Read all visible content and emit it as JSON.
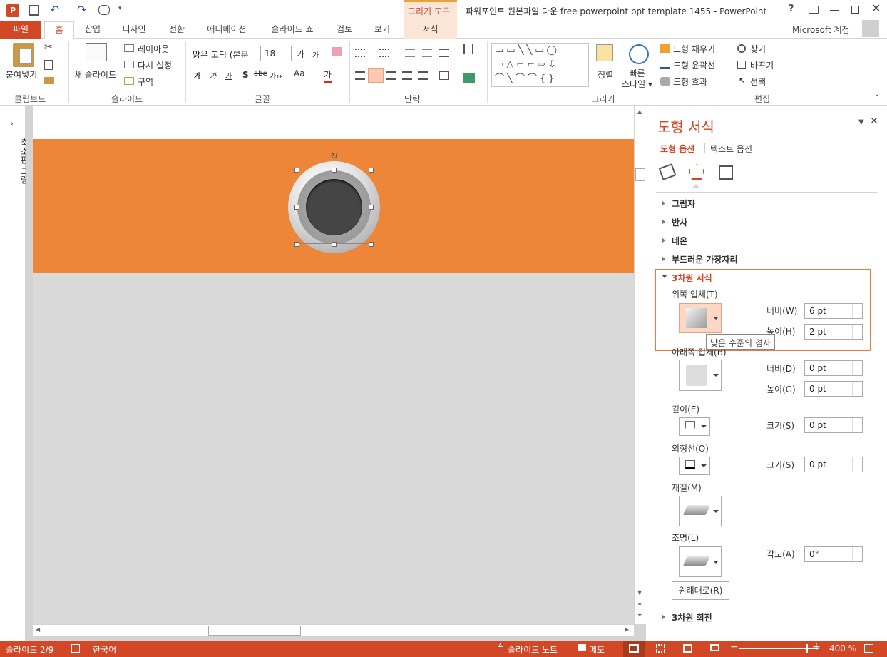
{
  "window": {
    "title": "파워포인트 원본파일 다운 free powerpoint ppt template 1455 - PowerPoint",
    "help": "?",
    "account": "Microsoft 계정"
  },
  "context_tab": {
    "group": "그리기 도구",
    "tab": "서식"
  },
  "tabs": [
    "파일",
    "홈",
    "삽입",
    "디자인",
    "전환",
    "애니메이션",
    "슬라이드 쇼",
    "검토",
    "보기"
  ],
  "ribbon": {
    "clipboard": {
      "paste": "붙여넣기",
      "label": "클립보드"
    },
    "slides": {
      "new_slide": "새 슬라이드",
      "layout": "레이아웃",
      "reset": "다시 설정",
      "section": "구역",
      "label": "슬라이드"
    },
    "font": {
      "name": "맑은 고딕 (본문",
      "size": "18",
      "label": "글꼴"
    },
    "paragraph": {
      "label": "단락"
    },
    "drawing": {
      "arrange": "정렬",
      "quick_styles": "빠른\n스타일",
      "fill": "도형 채우기",
      "outline": "도형 윤곽선",
      "effects": "도형 효과",
      "label": "그리기"
    },
    "editing": {
      "find": "찾기",
      "replace": "바꾸기",
      "select": "선택",
      "label": "편집"
    }
  },
  "left_strip": {
    "label": "축소판 그림"
  },
  "pane": {
    "title": "도형 서식",
    "tab_shape": "도형 옵션",
    "tab_text": "텍스트 옵션",
    "sections": {
      "shadow": "그림자",
      "reflection": "반사",
      "glow": "네온",
      "soft_edges": "부드러운 가장자리",
      "format3d": "3차원 서식",
      "rotation3d": "3차원 회전"
    },
    "top_bevel": {
      "label": "위쪽 입체(T)",
      "width_label": "너비(W)",
      "width": "6 pt",
      "height_label": "높이(H)",
      "height": "2 pt",
      "tooltip": "낮은 수준의 경사"
    },
    "bottom_bevel": {
      "label": "아래쪽 입체(B)",
      "width_label": "너비(D)",
      "width": "0 pt",
      "height_label": "높이(G)",
      "height": "0 pt"
    },
    "depth": {
      "label": "깊이(E)",
      "size_label": "크기(S)",
      "size": "0 pt"
    },
    "contour": {
      "label": "외형선(O)",
      "size_label": "크기(S)",
      "size": "0 pt"
    },
    "material": {
      "label": "재질(M)"
    },
    "lighting": {
      "label": "조명(L)",
      "angle_label": "각도(A)",
      "angle": "0°"
    },
    "reset": "원래대로(R)"
  },
  "status": {
    "slide": "슬라이드 2/9",
    "lang": "한국어",
    "notes": "슬라이드 노트",
    "comments": "메모",
    "zoom": "400 %"
  },
  "colors": {
    "accent": "#d24726",
    "orange_band": "#ed8638",
    "highlight_box": "#e87a3c"
  }
}
